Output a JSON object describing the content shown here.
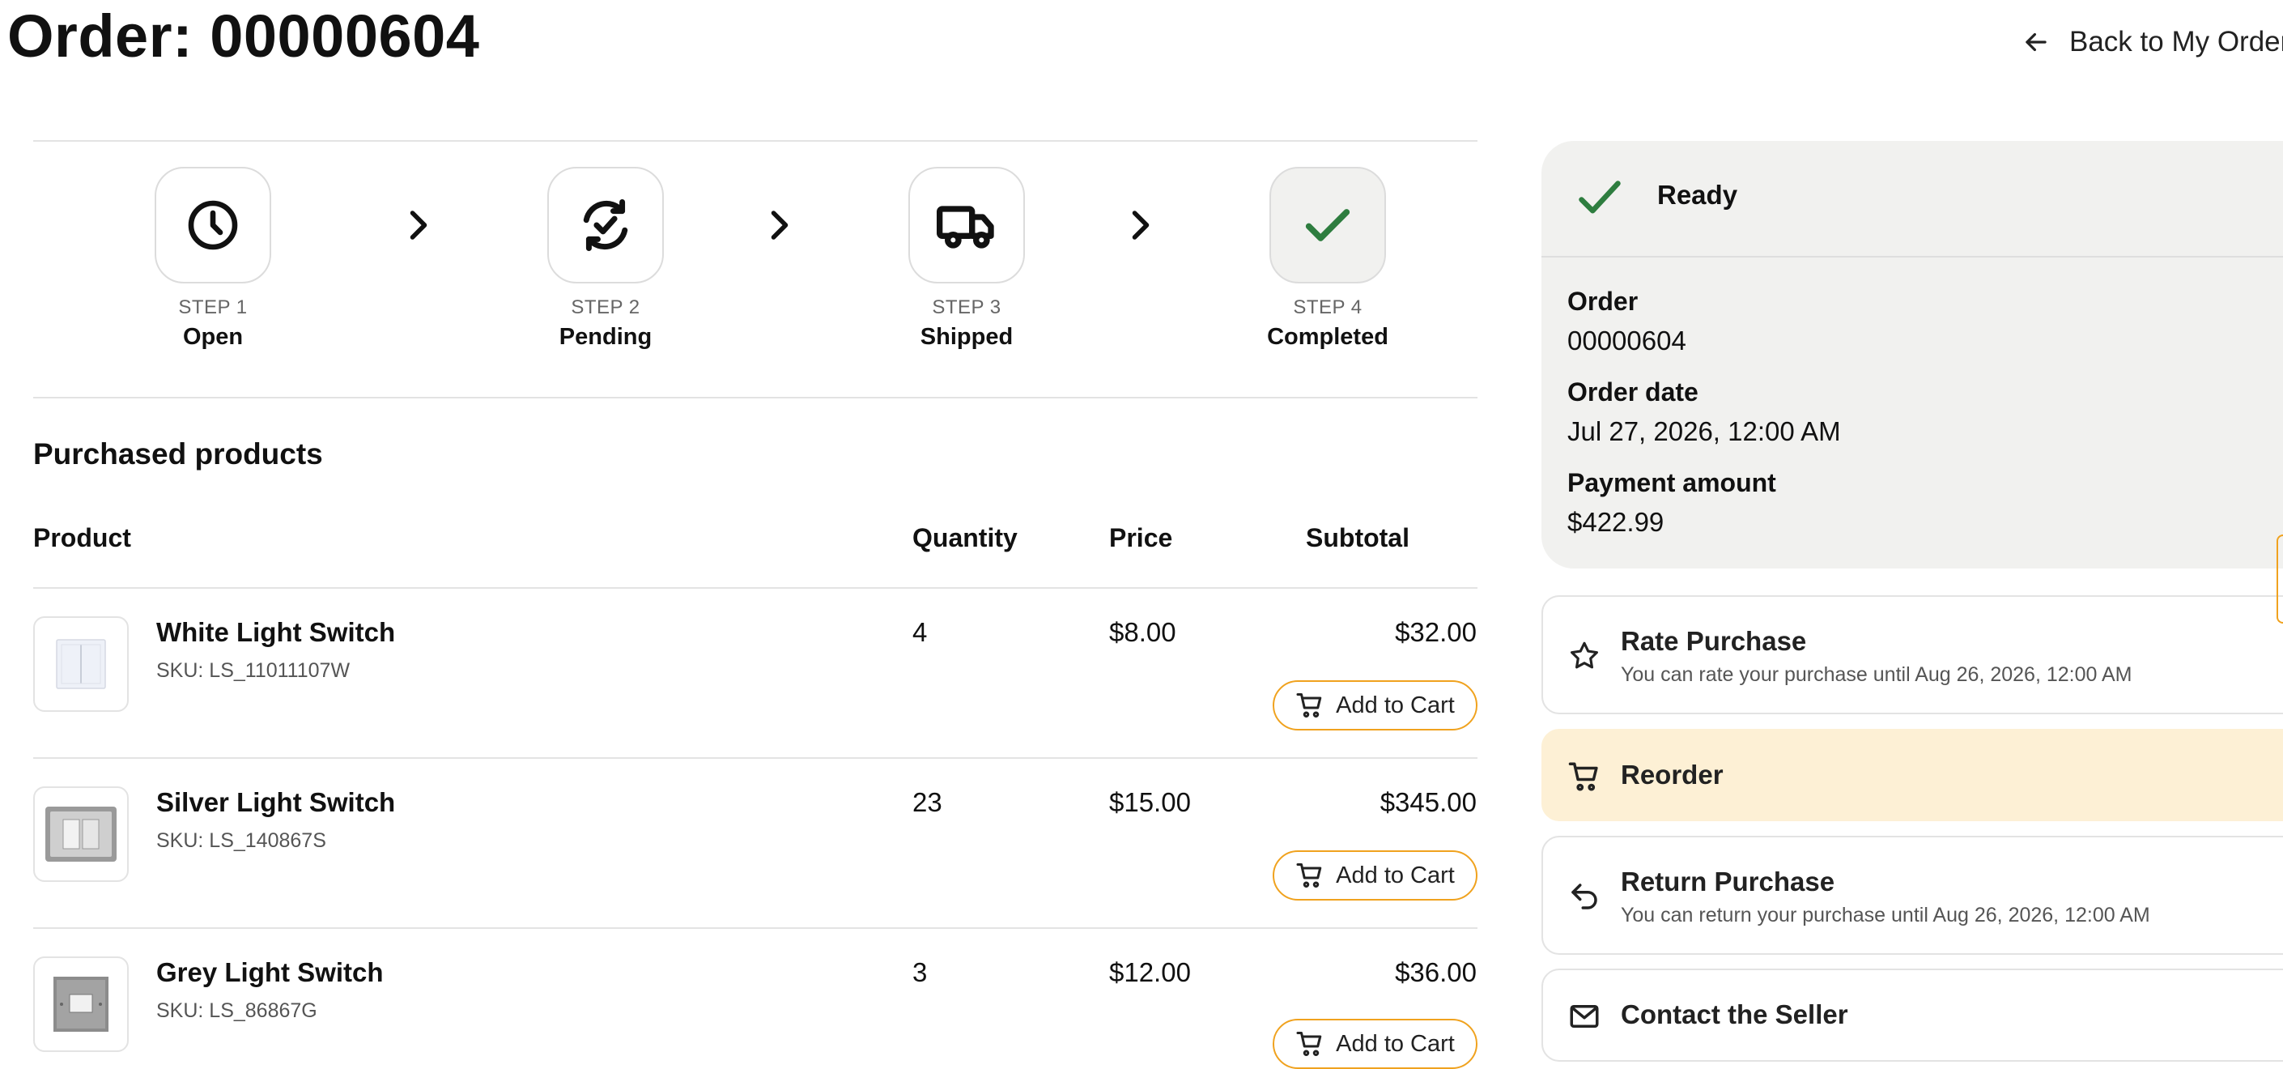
{
  "header": {
    "title": "Order: 00000604",
    "back_label": "Back to My Orders"
  },
  "stepper": {
    "steps": [
      {
        "number": "STEP 1",
        "label": "Open",
        "icon": "clock-icon"
      },
      {
        "number": "STEP 2",
        "label": "Pending",
        "icon": "sync-check-icon"
      },
      {
        "number": "STEP 3",
        "label": "Shipped",
        "icon": "truck-icon"
      },
      {
        "number": "STEP 4",
        "label": "Completed",
        "icon": "check-icon"
      }
    ],
    "current_step": 4
  },
  "products": {
    "heading": "Purchased products",
    "columns": [
      "Product",
      "Quantity",
      "Price",
      "Subtotal"
    ],
    "items": [
      {
        "name": "White Light Switch",
        "sku": "SKU: LS_11011107W",
        "quantity": "4",
        "price": "$8.00",
        "subtotal": "$32.00",
        "button": "Add to Cart"
      },
      {
        "name": "Silver Light Switch",
        "sku": "SKU: LS_140867S",
        "quantity": "23",
        "price": "$15.00",
        "subtotal": "$345.00",
        "button": "Add to Cart"
      },
      {
        "name": "Grey Light Switch",
        "sku": "SKU: LS_86867G",
        "quantity": "3",
        "price": "$12.00",
        "subtotal": "$36.00",
        "button": "Add to Cart"
      }
    ]
  },
  "summary": {
    "status": "Ready",
    "order_label": "Order",
    "order_value": "00000604",
    "date_label": "Order date",
    "date_value": "Jul 27, 2026, 12:00 AM",
    "amount_label": "Payment amount",
    "amount_value": "$422.99"
  },
  "actions": {
    "rate": {
      "title": "Rate Purchase",
      "subtitle": "You can rate your purchase until Aug 26, 2026, 12:00 AM"
    },
    "reorder": {
      "title": "Reorder"
    },
    "return": {
      "title": "Return Purchase",
      "subtitle": "You can return your purchase until Aug 26, 2026, 12:00 AM"
    },
    "contact": {
      "title": "Contact the Seller"
    }
  },
  "colors": {
    "accent": "#f0a21e",
    "success": "#2e7d3f",
    "card_bg": "#f1f1ef",
    "highlight_bg": "#fdf0d5"
  }
}
